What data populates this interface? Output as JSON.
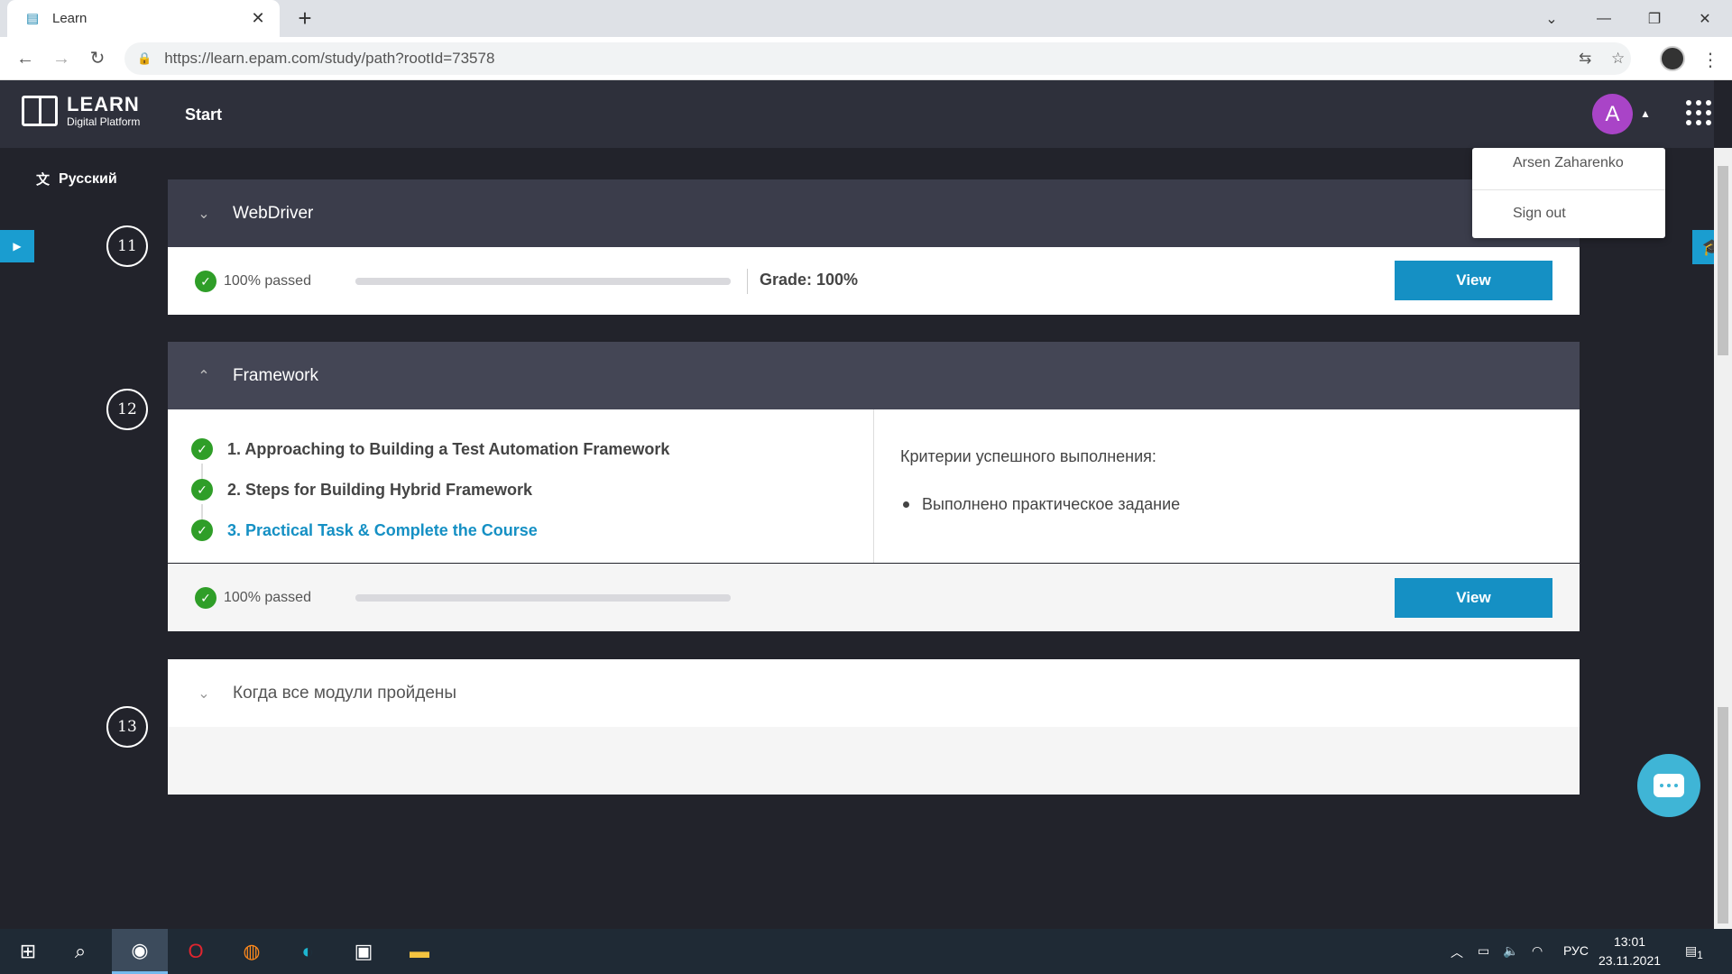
{
  "browser": {
    "tab_title": "Learn",
    "tab_close": "✕",
    "new_tab": "+",
    "url": "https://learn.epam.com/study/path?rootId=73578"
  },
  "header": {
    "logo_title": "LEARN",
    "logo_subtitle": "Digital Platform",
    "nav_start": "Start",
    "avatar_letter": "A"
  },
  "user_menu": {
    "name": "Arsen Zaharenko",
    "sign_out": "Sign out"
  },
  "sidebar": {
    "language": "Русский"
  },
  "modules": [
    {
      "number": "11",
      "title": "WebDriver",
      "status": "100% passed",
      "progress": 1.0,
      "grade": "Grade: 100%",
      "view_label": "View"
    },
    {
      "number": "12",
      "title": "Framework",
      "lessons": [
        "1. Approaching to Building a Test Automation Framework",
        "2. Steps for Building Hybrid Framework",
        "3. Practical Task & Complete the Course"
      ],
      "criteria_title": "Критерии успешного выполнения:",
      "criteria_items": [
        "Выполнено практическое задание"
      ],
      "status": "100% passed",
      "progress": 1.0,
      "view_label": "View"
    },
    {
      "number": "13",
      "title": "Когда все модули пройдены"
    }
  ],
  "taskbar": {
    "lang": "РУС",
    "time": "13:01",
    "date": "23.11.2021",
    "notification_count": "1"
  }
}
